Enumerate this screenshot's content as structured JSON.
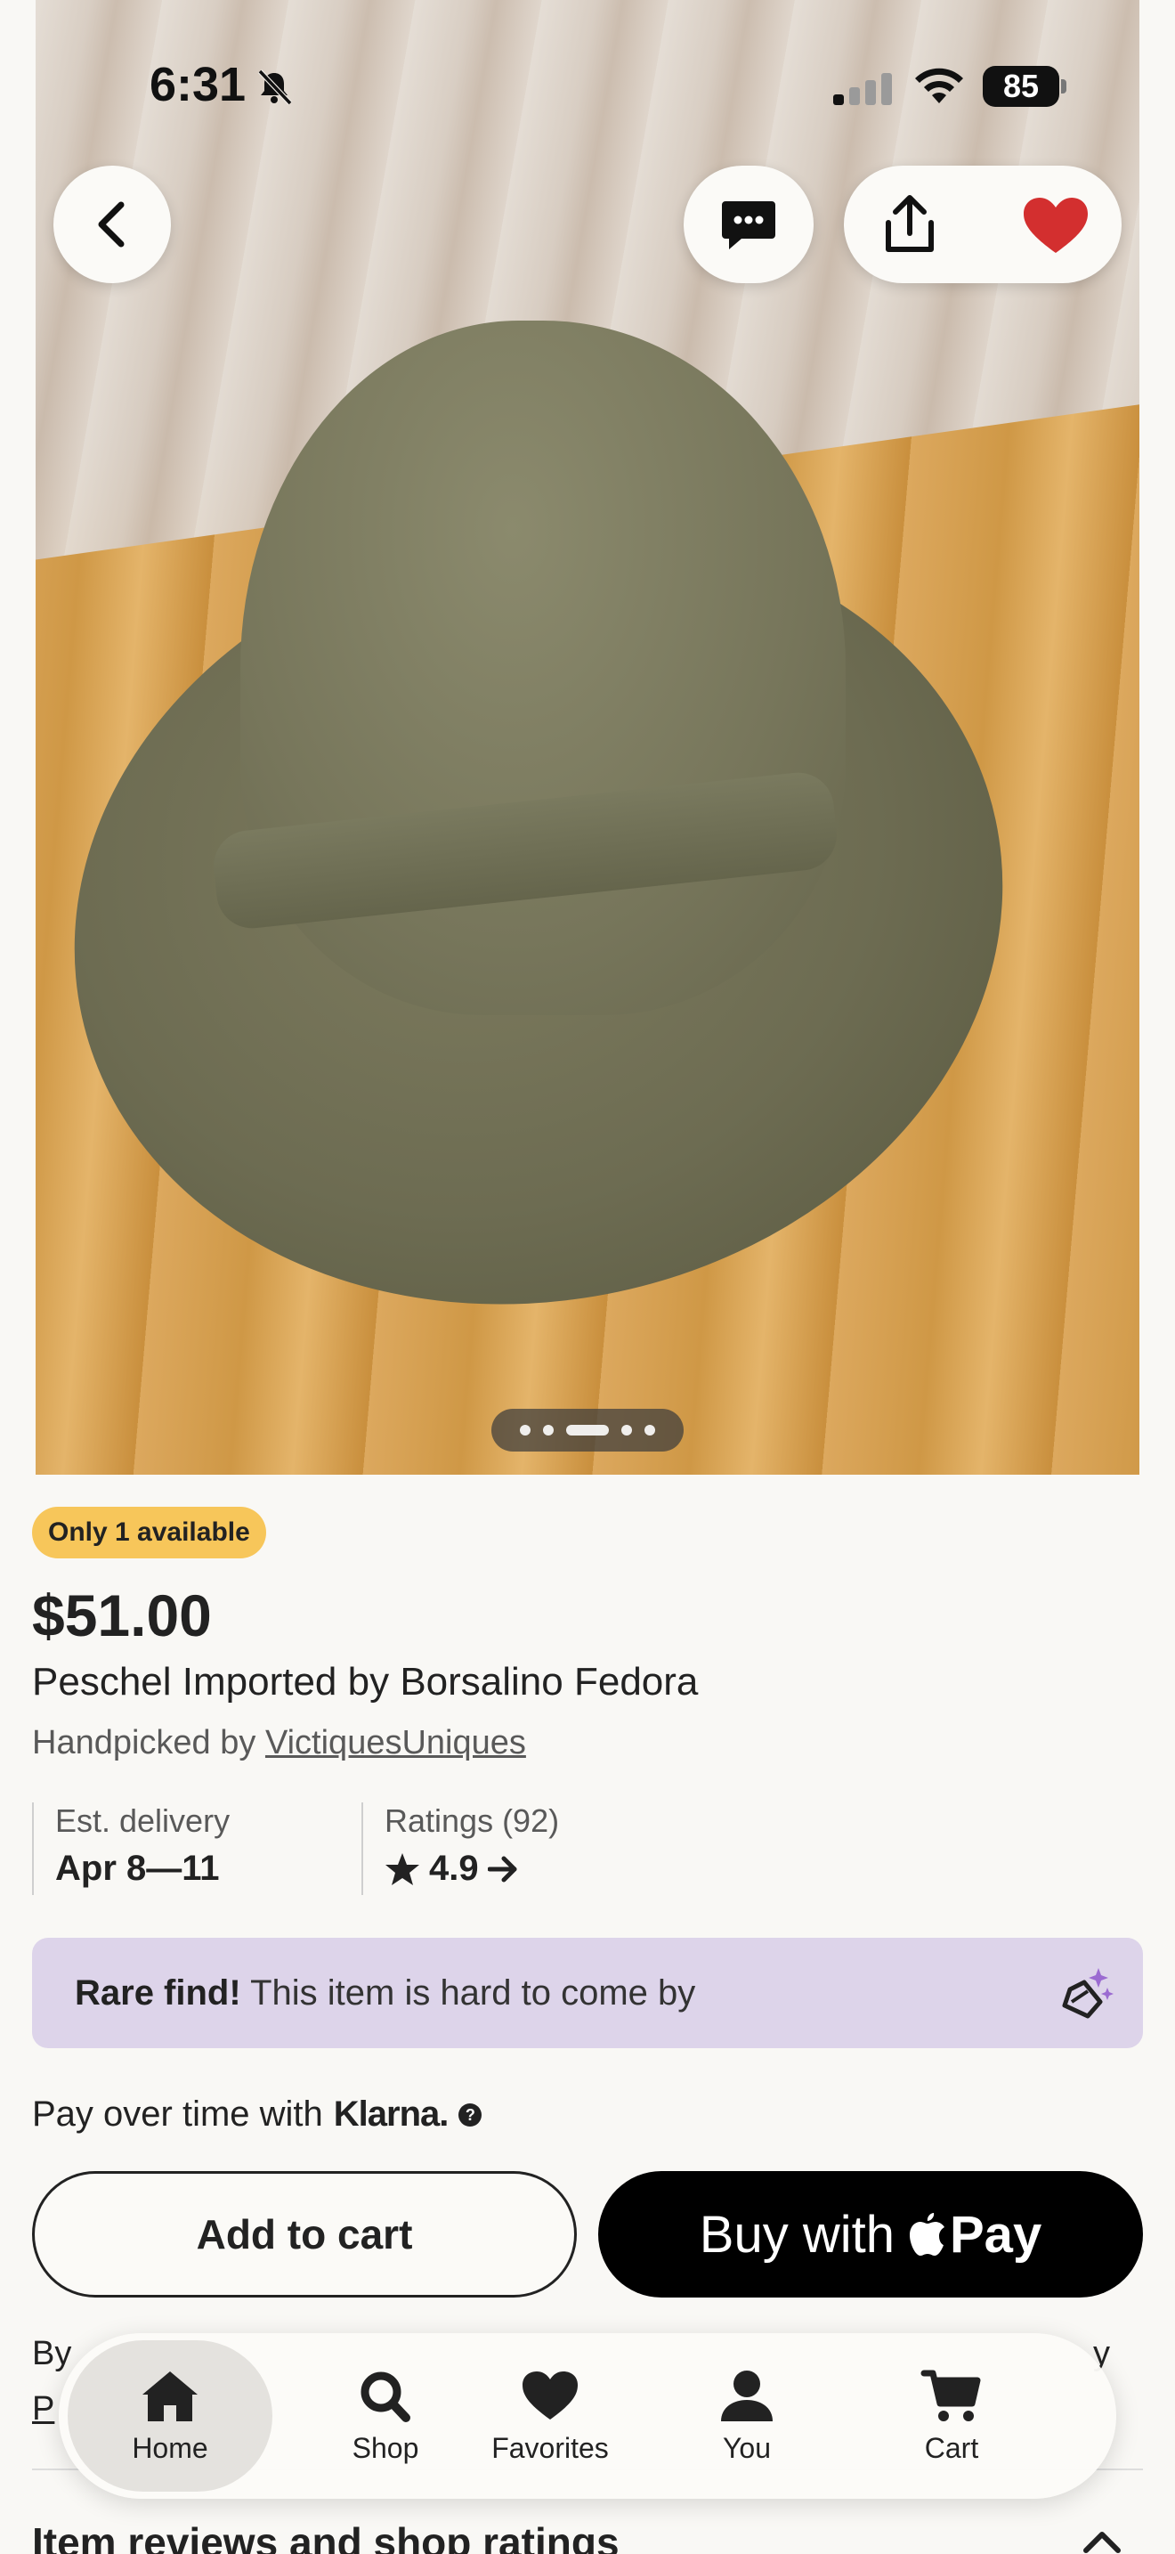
{
  "status_bar": {
    "time": "6:31",
    "battery": "85"
  },
  "gallery": {
    "image_count": 6,
    "active_index": 2
  },
  "listing": {
    "stock_badge": "Only 1 available",
    "price": "$51.00",
    "title": "Peschel Imported by Borsalino Fedora",
    "handpicked_prefix": "Handpicked by",
    "shop_name": "VictiquesUniques",
    "delivery_label": "Est. delivery",
    "delivery_value": "Apr 8—11",
    "ratings_label": "Ratings (92)",
    "ratings_value": "4.9",
    "rare_title": "Rare find!",
    "rare_text": "This item is hard to come by",
    "klarna_prefix": "Pay over time with",
    "klarna_brand": "Klarna.",
    "klarna_help": "?",
    "add_to_cart": "Add to cart",
    "buy_prefix": "Buy with",
    "buy_suffix": "Pay",
    "legal_start": "By",
    "legal_end": "y",
    "legal_link": "P",
    "reviews_heading": "Item reviews and shop ratings"
  },
  "tabbar": {
    "items": [
      {
        "label": "Home",
        "icon": "home-icon",
        "active": true
      },
      {
        "label": "Shop",
        "icon": "search-icon"
      },
      {
        "label": "Favorites",
        "icon": "heart-icon"
      },
      {
        "label": "You",
        "icon": "person-icon"
      },
      {
        "label": "Cart",
        "icon": "cart-icon"
      }
    ]
  },
  "colors": {
    "badge": "#f7c65a",
    "rare_bg": "#ddd4ea",
    "favorite_heart": "#d32f2f",
    "accent_dark": "#222222"
  }
}
